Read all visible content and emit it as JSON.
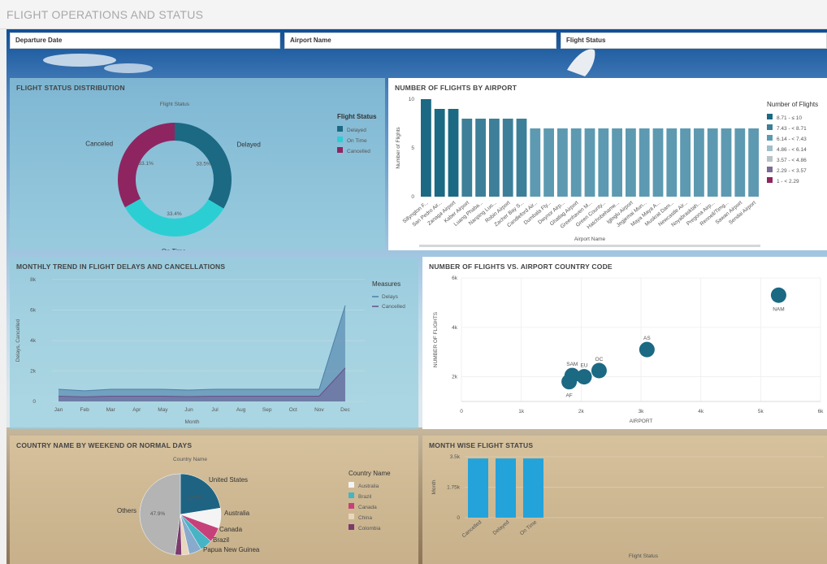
{
  "app": {
    "title": "FLIGHT OPERATIONS AND STATUS"
  },
  "filters": {
    "departure_date": "Departure Date",
    "airport_name": "Airport Name",
    "flight_status": "Flight Status"
  },
  "panels": {
    "status_distribution": "FLIGHT STATUS DISTRIBUTION",
    "flights_by_airport": "NUMBER OF FLIGHTS BY AIRPORT",
    "monthly_trend": "MONTHLY TREND IN FLIGHT DELAYS AND CANCELLATIONS",
    "flights_vs_country": "NUMBER OF FLIGHTS VS. AIRPORT COUNTRY CODE",
    "country_weekend": "COUNTRY NAME BY WEEKEND OR NORMAL DAYS",
    "month_wise_status": "MONTH WISE FLIGHT STATUS"
  },
  "colors": {
    "dark_teal": "#1b6983",
    "mid_teal": "#5d9ab1",
    "light_teal": "#8db7c8",
    "cyan": "#2bcfd3",
    "maroon": "#8e2561",
    "bar_blue": "#23a3da",
    "pie_grey": "#b4b4b4",
    "pie_blue": "#1f6382"
  },
  "chart_data": [
    {
      "type": "pie",
      "subtitle": "Flight Status",
      "legend_title": "Flight Status",
      "legend_position": "right",
      "slices": [
        {
          "label": "Delayed",
          "value": 33.5,
          "value_label": "33.5%",
          "color": "#1b6983"
        },
        {
          "label": "On Time",
          "value": 33.4,
          "value_label": "33.4%",
          "color": "#2bcfd3"
        },
        {
          "label": "Cancelled",
          "value": 33.1,
          "value_label": "33.1%",
          "color": "#8e2561"
        }
      ],
      "outer_labels": [
        "Delayed",
        "On Time",
        "Canceled"
      ],
      "legend_labels": [
        "Delayed",
        "On Time",
        "Cancelled"
      ]
    },
    {
      "type": "bar",
      "xlabel": "Airport Name",
      "ylabel": "Number of Flights",
      "ylim": [
        0,
        10
      ],
      "yticks": [
        "0",
        "5",
        "10"
      ],
      "legend_title": "Number of Flights",
      "legend_position": "right",
      "legend": [
        {
          "label": "8.71 - ≤ 10",
          "color": "#1b6983"
        },
        {
          "label": "7.43 - < 8.71",
          "color": "#3d7f98"
        },
        {
          "label": "6.14 - < 7.43",
          "color": "#5d9ab1"
        },
        {
          "label": "4.86 - < 6.14",
          "color": "#9fbfcb"
        },
        {
          "label": "3.57 - < 4.86",
          "color": "#b9c2c7"
        },
        {
          "label": "2.29 - < 3.57",
          "color": "#7a6c93"
        },
        {
          "label": "1 - < 2.29",
          "color": "#8e2561"
        }
      ],
      "categories": [
        "Sillyngton F...",
        "San Pedro Air...",
        "Zanaga Airport",
        "Kaber Airport",
        "Luang Phaba...",
        "Nanping Luo...",
        "Robin Airport",
        "Zacher Bay S...",
        "Candleford Air...",
        "Dumbala Fly...",
        "Dwynor Airp...",
        "Ghatlag Airport",
        "Greenhaven M...",
        "Green County...",
        "Hatchobehame...",
        "Igloglu Airport",
        "Jegjemai Mun...",
        "Maya Maya A...",
        "Muskrat Dam...",
        "Newcastle Air...",
        "Noyabrasktah...",
        "Pregona Airp...",
        "Rennell/Timg...",
        "Sawan Airport",
        "Sendai Airport"
      ],
      "values": [
        10,
        9,
        9,
        8,
        8,
        8,
        8,
        8,
        7,
        7,
        7,
        7,
        7,
        7,
        7,
        7,
        7,
        7,
        7,
        7,
        7,
        7,
        7,
        7,
        7
      ]
    },
    {
      "type": "area",
      "xlabel": "Month",
      "ylabel": "Delays, Cancelled",
      "ylim": [
        0,
        8000
      ],
      "yticks": [
        "0",
        "2k",
        "4k",
        "6k",
        "8k"
      ],
      "legend_title": "Measures",
      "legend_position": "top-right",
      "categories": [
        "Jan",
        "Feb",
        "Mar",
        "Apr",
        "May",
        "Jun",
        "Jul",
        "Aug",
        "Sep",
        "Oct",
        "Nov",
        "Dec"
      ],
      "series": [
        {
          "name": "Delays",
          "values": [
            800,
            700,
            800,
            800,
            800,
            750,
            800,
            800,
            800,
            800,
            800,
            6300
          ],
          "color": "#4d7fa8"
        },
        {
          "name": "Cancelled",
          "values": [
            350,
            300,
            350,
            350,
            350,
            320,
            350,
            350,
            350,
            350,
            350,
            2200
          ],
          "color": "#6a4f8a"
        }
      ],
      "extra_point": {
        "x_after": "Dec",
        "value": 6500
      }
    },
    {
      "type": "scatter",
      "xlabel": "AIRPORT",
      "ylabel": "NUMBER OF FLIGHTS",
      "xlim": [
        0,
        6000
      ],
      "ylim": [
        0,
        6000
      ],
      "xticks": [
        "0",
        "1k",
        "2k",
        "3k",
        "4k",
        "5k",
        "6k"
      ],
      "yticks": [
        "2k",
        "4k",
        "6k"
      ],
      "points": [
        {
          "label": "AF",
          "x": 1800,
          "y": 1800
        },
        {
          "label": "SAM",
          "x": 1850,
          "y": 2050
        },
        {
          "label": "EU",
          "x": 2050,
          "y": 2000
        },
        {
          "label": "OC",
          "x": 2300,
          "y": 2250
        },
        {
          "label": "AS",
          "x": 3100,
          "y": 3100
        },
        {
          "label": "NAM",
          "x": 5300,
          "y": 5300
        }
      ]
    },
    {
      "type": "pie",
      "subtitle": "Country Name",
      "legend_title": "Country Name",
      "legend_position": "right",
      "slices": [
        {
          "label": "United States",
          "value": 22.5,
          "value_label": "22.5%",
          "color": "#1f6382"
        },
        {
          "label": "Australia",
          "value": 8,
          "color": "#f4f4f4"
        },
        {
          "label": "Canada",
          "value": 6,
          "color": "#c6417a"
        },
        {
          "label": "Brazil",
          "value": 5,
          "color": "#46b4c4"
        },
        {
          "label": "Papua New Guinea",
          "value": 5,
          "color": "#88aacc"
        },
        {
          "label": "China",
          "value": 3,
          "color": "#e8d6bd"
        },
        {
          "label": "Colombia",
          "value": 2.6,
          "color": "#7b3b6d"
        },
        {
          "label": "Others",
          "value": 47.9,
          "value_label": "47.9%",
          "color": "#b4b4b4"
        }
      ],
      "legend_labels": [
        "Australia",
        "Brazil",
        "Canada",
        "China",
        "Colombia"
      ]
    },
    {
      "type": "bar",
      "xlabel": "Flight Status",
      "ylabel": "Month",
      "ylim": [
        0,
        3.5
      ],
      "yticks": [
        "0",
        "1.75k",
        "3.5k"
      ],
      "categories": [
        "Cancelled",
        "Delayed",
        "On Time"
      ],
      "values": [
        3.4,
        3.4,
        3.4
      ]
    }
  ]
}
